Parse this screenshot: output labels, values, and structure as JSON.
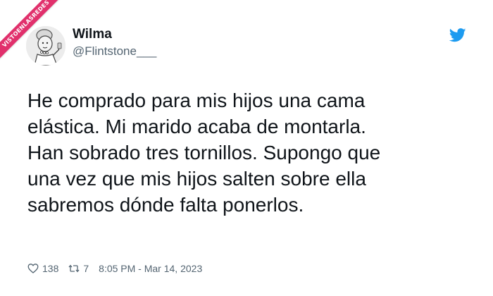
{
  "watermark": {
    "text": "VISTOENLASREDES",
    "color": "#e1306c"
  },
  "author": {
    "name": "Wilma",
    "handle": "@Flintstone___",
    "avatar_icon": "avatar-illustration"
  },
  "brand": {
    "icon": "twitter-bird-icon",
    "color": "#1d9bf0"
  },
  "tweet": {
    "text": "He comprado para mis hijos una cama\nelástica. Mi marido acaba de montarla.\nHan sobrado tres tornillos. Supongo que\nuna vez que mis hijos salten sobre ella\nsabremos dónde falta ponerlos."
  },
  "footer": {
    "likes": "138",
    "like_icon": "heart-icon",
    "retweets": "7",
    "retweet_icon": "retweet-icon",
    "timestamp": "8:05 PM - Mar 14, 2023"
  }
}
